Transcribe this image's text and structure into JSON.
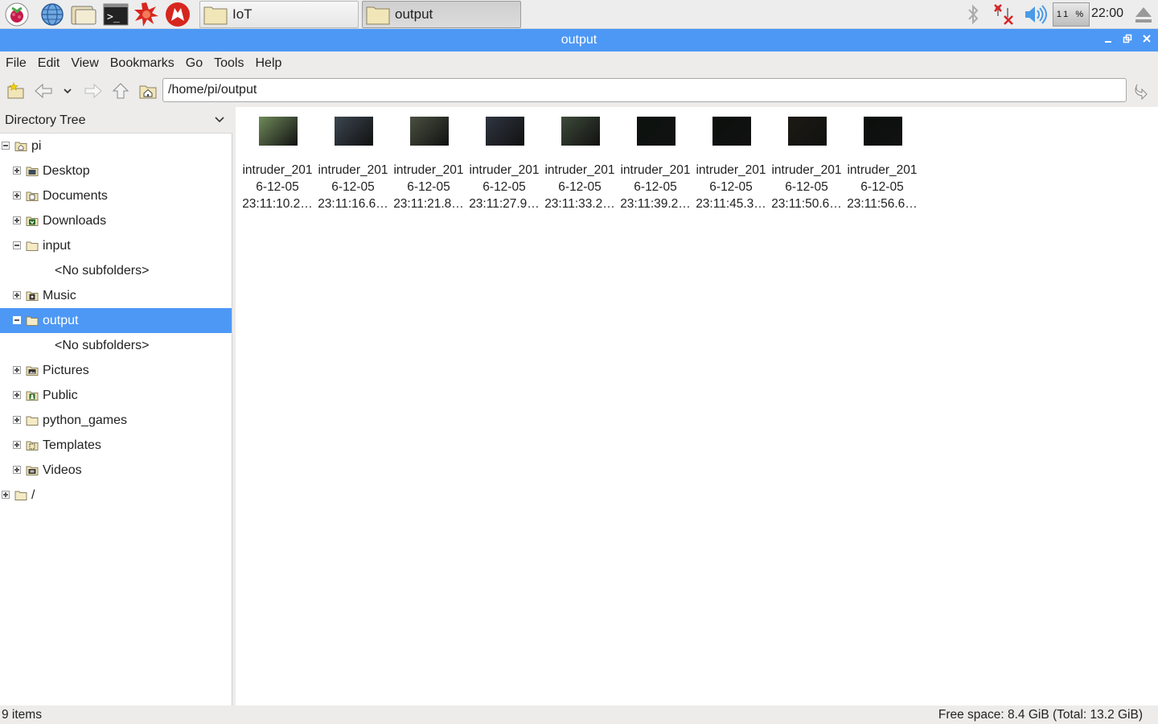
{
  "panel": {
    "launchers": [
      "raspberry-menu",
      "web-browser",
      "file-manager",
      "terminal",
      "mathematica",
      "wolfram"
    ],
    "tasks": [
      {
        "label": "IoT",
        "active": false
      },
      {
        "label": "output",
        "active": true
      }
    ],
    "cpu_label": "11 %",
    "clock": "22:00"
  },
  "window": {
    "title": "output",
    "controls": [
      "minimize",
      "maximize",
      "close"
    ]
  },
  "menu": [
    "File",
    "Edit",
    "View",
    "Bookmarks",
    "Go",
    "Tools",
    "Help"
  ],
  "toolbar": {
    "path": "/home/pi/output"
  },
  "sidepanel": {
    "header": "Directory Tree",
    "tree": [
      {
        "label": "pi",
        "expanded": true,
        "depth": 0,
        "icon": "home-folder-icon"
      },
      {
        "label": "Desktop",
        "expanded": false,
        "depth": 1,
        "icon": "desktop-folder-icon"
      },
      {
        "label": "Documents",
        "expanded": false,
        "depth": 1,
        "icon": "documents-folder-icon"
      },
      {
        "label": "Downloads",
        "expanded": false,
        "depth": 1,
        "icon": "downloads-folder-icon"
      },
      {
        "label": "input",
        "expanded": true,
        "depth": 1,
        "icon": "folder-icon"
      },
      {
        "label": "<No subfolders>",
        "depth": 2,
        "placeholder": true
      },
      {
        "label": "Music",
        "expanded": false,
        "depth": 1,
        "icon": "music-folder-icon"
      },
      {
        "label": "output",
        "expanded": true,
        "depth": 1,
        "icon": "folder-icon",
        "selected": true
      },
      {
        "label": "<No subfolders>",
        "depth": 2,
        "placeholder": true
      },
      {
        "label": "Pictures",
        "expanded": false,
        "depth": 1,
        "icon": "pictures-folder-icon"
      },
      {
        "label": "Public",
        "expanded": false,
        "depth": 1,
        "icon": "public-folder-icon"
      },
      {
        "label": "python_games",
        "expanded": false,
        "depth": 1,
        "icon": "folder-icon"
      },
      {
        "label": "Templates",
        "expanded": false,
        "depth": 1,
        "icon": "templates-folder-icon"
      },
      {
        "label": "Videos",
        "expanded": false,
        "depth": 1,
        "icon": "videos-folder-icon"
      },
      {
        "label": "/",
        "expanded": false,
        "depth": 0,
        "icon": "folder-icon"
      }
    ]
  },
  "files": [
    {
      "line1": "intruder_201",
      "line2": "6-12-05",
      "line3": "23:11:10.2…",
      "thumb_color": "#6f8a5a"
    },
    {
      "line1": "intruder_201",
      "line2": "6-12-05",
      "line3": "23:11:16.6…",
      "thumb_color": "#3b4650"
    },
    {
      "line1": "intruder_201",
      "line2": "6-12-05",
      "line3": "23:11:21.8…",
      "thumb_color": "#4a5040"
    },
    {
      "line1": "intruder_201",
      "line2": "6-12-05",
      "line3": "23:11:27.9…",
      "thumb_color": "#2f3540"
    },
    {
      "line1": "intruder_201",
      "line2": "6-12-05",
      "line3": "23:11:33.2…",
      "thumb_color": "#3d4a3a"
    },
    {
      "line1": "intruder_201",
      "line2": "6-12-05",
      "line3": "23:11:39.2…",
      "thumb_color": "#0c120e"
    },
    {
      "line1": "intruder_201",
      "line2": "6-12-05",
      "line3": "23:11:45.3…",
      "thumb_color": "#0b110d"
    },
    {
      "line1": "intruder_201",
      "line2": "6-12-05",
      "line3": "23:11:50.6…",
      "thumb_color": "#1c1a12"
    },
    {
      "line1": "intruder_201",
      "line2": "6-12-05",
      "line3": "23:11:56.6…",
      "thumb_color": "#0a100c"
    }
  ],
  "status": {
    "left": "9 items",
    "right": "Free space: 8.4 GiB (Total: 13.2 GiB)"
  }
}
